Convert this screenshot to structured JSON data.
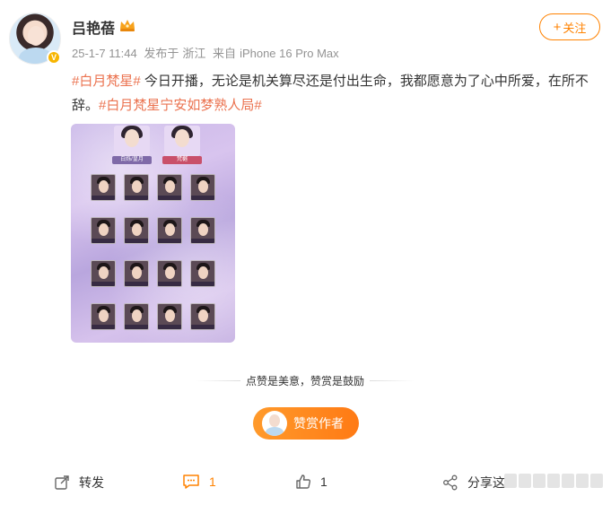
{
  "post": {
    "author": "吕艳蓓",
    "date": "25-1-7 11:44",
    "posted_from_label": "发布于",
    "location": "浙江",
    "source_label": "来自",
    "device": "iPhone 16 Pro Max",
    "follow_label": "关注",
    "follow_plus": "+",
    "verified_badge": "V",
    "tag1": "#白月梵星#",
    "body": " 今日开播，无论是机关算尽还是付出生命，我都愿意为了心中所爱，在所不辞。",
    "tag2": "#白月梵星宁安如梦熟人局#"
  },
  "image": {
    "lead_left_label": "白烁/皇月",
    "lead_right_label": "梵樾"
  },
  "reward": {
    "prompt": "点赞是美意，赞赏是鼓励",
    "button_label": "赞赏作者"
  },
  "actions": {
    "repost_label": "转发",
    "comment_count": "1",
    "like_count": "1",
    "share_label": "分享这"
  },
  "colors": {
    "accent": "#ff8200",
    "tag": "#eb7350",
    "meta": "#939393"
  },
  "icons": [
    "crown-icon",
    "repost-icon",
    "comment-icon",
    "like-icon",
    "share-icon",
    "plus-icon"
  ]
}
